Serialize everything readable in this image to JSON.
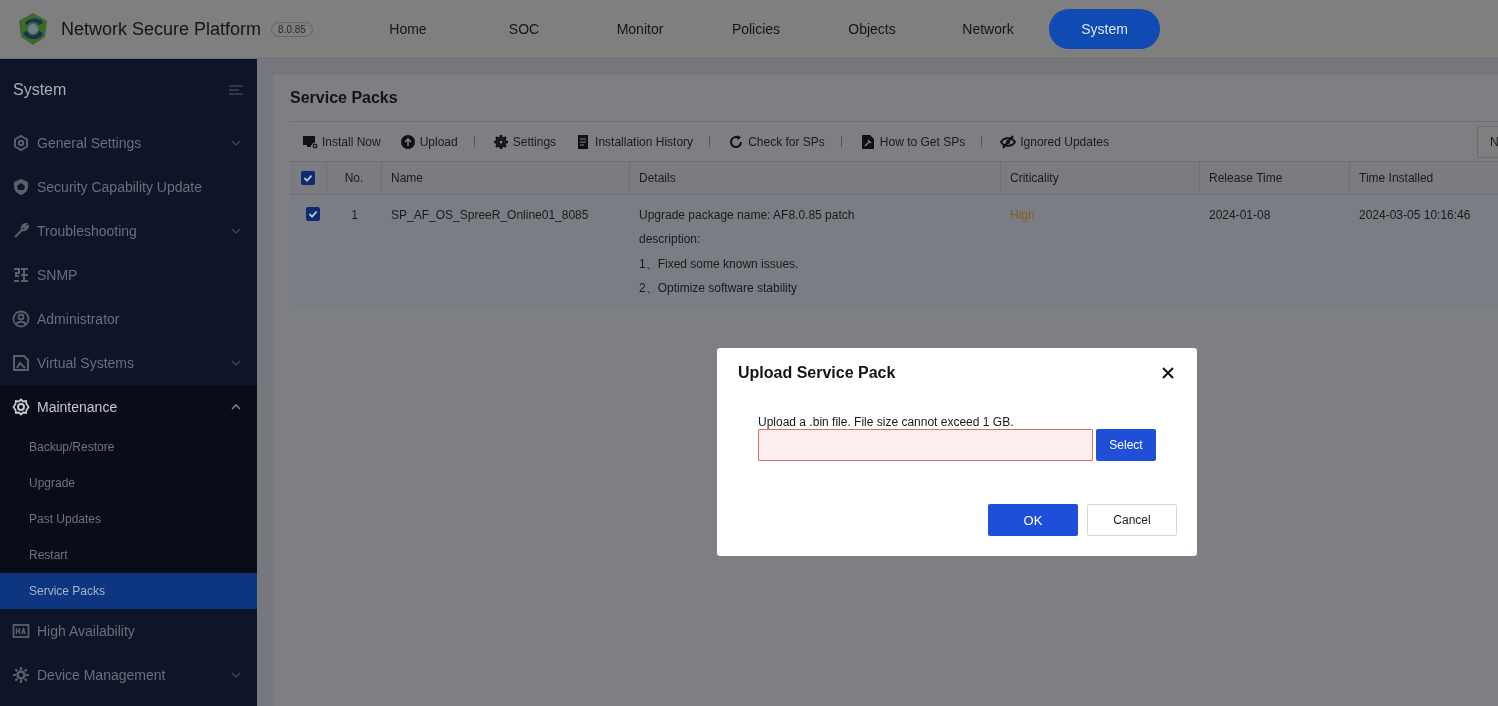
{
  "header": {
    "product": "Network Secure Platform",
    "version": "8.0.85",
    "nav": [
      {
        "label": "Home",
        "selected": false
      },
      {
        "label": "SOC",
        "selected": false
      },
      {
        "label": "Monitor",
        "selected": false
      },
      {
        "label": "Policies",
        "selected": false
      },
      {
        "label": "Objects",
        "selected": false
      },
      {
        "label": "Network",
        "selected": false
      },
      {
        "label": "System",
        "selected": true
      }
    ]
  },
  "sidebar": {
    "title": "System",
    "items": [
      {
        "label": "General Settings",
        "selected": false,
        "expanded": false
      },
      {
        "label": "Security Capability Update",
        "selected": false
      },
      {
        "label": "Troubleshooting",
        "selected": false,
        "expanded": false
      },
      {
        "label": "SNMP",
        "selected": false
      },
      {
        "label": "Administrator",
        "selected": false
      },
      {
        "label": "Virtual Systems",
        "selected": false,
        "expanded": false
      },
      {
        "label": "Maintenance",
        "selected": false,
        "expanded": true,
        "children": [
          {
            "label": "Backup/Restore",
            "selected": false
          },
          {
            "label": "Upgrade",
            "selected": false
          },
          {
            "label": "Past Updates",
            "selected": false
          },
          {
            "label": "Restart",
            "selected": false
          },
          {
            "label": "Service Packs",
            "selected": true
          }
        ]
      },
      {
        "label": "High Availability",
        "selected": false
      },
      {
        "label": "Device Management",
        "selected": false,
        "expanded": false
      }
    ]
  },
  "page": {
    "title": "Service Packs",
    "toolbar": [
      {
        "label": "Install Now",
        "separator_before": false
      },
      {
        "label": "Upload",
        "separator_before": false
      },
      {
        "label": "Settings",
        "separator_before": true
      },
      {
        "label": "Installation History",
        "separator_before": false
      },
      {
        "label": "Check for SPs",
        "separator_before": true
      },
      {
        "label": "How to Get SPs",
        "separator_before": true
      },
      {
        "label": "Ignored Updates",
        "separator_before": true
      }
    ],
    "right_button": "N",
    "table": {
      "all_checked": true,
      "columns": [
        "No.",
        "Name",
        "Details",
        "Criticality",
        "Release Time",
        "Time Installed"
      ],
      "rows": [
        {
          "checked": true,
          "no": "1",
          "name": "SP_AF_OS_SpreeR_Online01_8085",
          "details": [
            "Upgrade package name: AF8.0.85 patch",
            "description:",
            "1、Fixed some known issues.",
            "2、Optimize software stability"
          ],
          "criticality": "High",
          "release_time": "2024-01-08",
          "time_installed": "2024-03-05 10:16:46"
        }
      ]
    }
  },
  "dialog": {
    "title": "Upload Service Pack",
    "hint": "Upload a .bin file. File size cannot exceed 1 GB.",
    "field_invalid": true,
    "select": "Select",
    "ok": "OK",
    "cancel": "Cancel"
  }
}
